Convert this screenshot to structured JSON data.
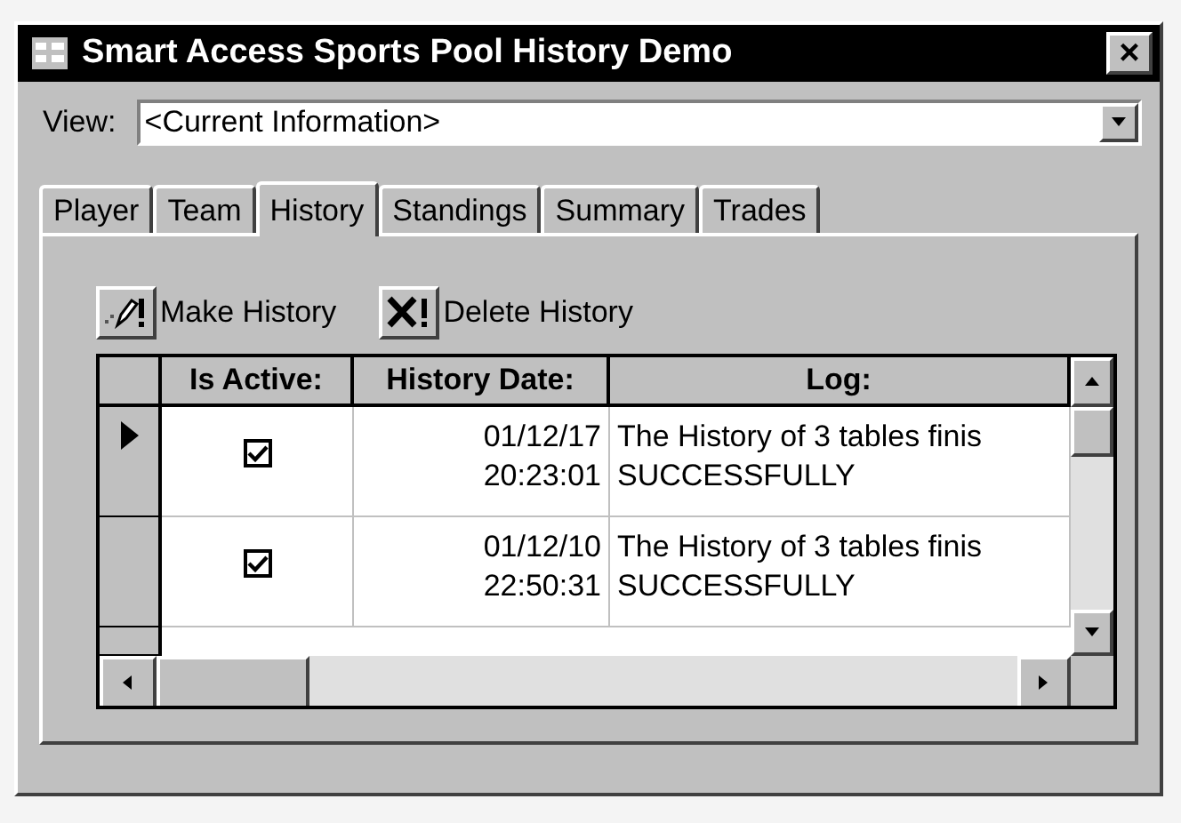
{
  "window": {
    "title": "Smart Access Sports Pool History Demo",
    "close": "×"
  },
  "view": {
    "label": "View:",
    "value": "<Current Information>"
  },
  "tabs": [
    {
      "label": "Player",
      "selected": false
    },
    {
      "label": "Team",
      "selected": false
    },
    {
      "label": "History",
      "selected": true
    },
    {
      "label": "Standings",
      "selected": false
    },
    {
      "label": "Summary",
      "selected": false
    },
    {
      "label": "Trades",
      "selected": false
    }
  ],
  "toolbar": [
    {
      "kind": "make",
      "label": "Make History"
    },
    {
      "kind": "delete",
      "label": "Delete History"
    }
  ],
  "table": {
    "columns": [
      "Is Active:",
      "History Date:",
      "Log:"
    ],
    "rows": [
      {
        "current": true,
        "active": true,
        "date": "01/12/17",
        "time": "20:23:01",
        "log": "The History of 3 tables finis",
        "log2": "SUCCESSFULLY"
      },
      {
        "current": false,
        "active": true,
        "date": "01/12/10",
        "time": "22:50:31",
        "log": "The History of 3 tables finis",
        "log2": "SUCCESSFULLY"
      }
    ]
  }
}
